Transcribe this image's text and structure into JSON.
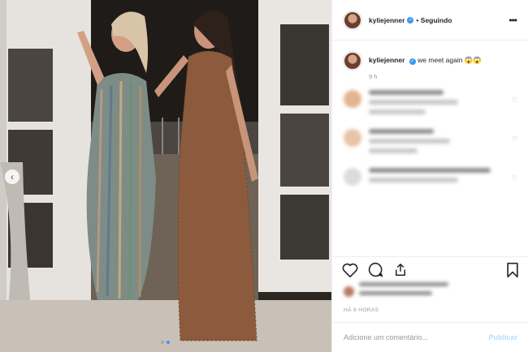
{
  "post": {
    "username": "kyliejenner",
    "follow_separator": "•",
    "follow_status": "Seguindo",
    "more_icon": "ellipsis-icon",
    "caption_text": "we meet again 😱😱",
    "caption_age": "9 h",
    "timestamp": "HÁ 9 HORAS",
    "comment_placeholder": "Adicione um comentário...",
    "publish_label": "Publicar",
    "carousel": {
      "total": 2,
      "current": 2
    }
  },
  "actions": {
    "like_icon": "heart-icon",
    "comment_icon": "comment-icon",
    "share_icon": "share-icon",
    "save_icon": "bookmark-icon"
  },
  "colors": {
    "accent": "#3897f0",
    "publish_disabled": "#b2dffc",
    "muted": "#999999",
    "border": "#efefef"
  }
}
